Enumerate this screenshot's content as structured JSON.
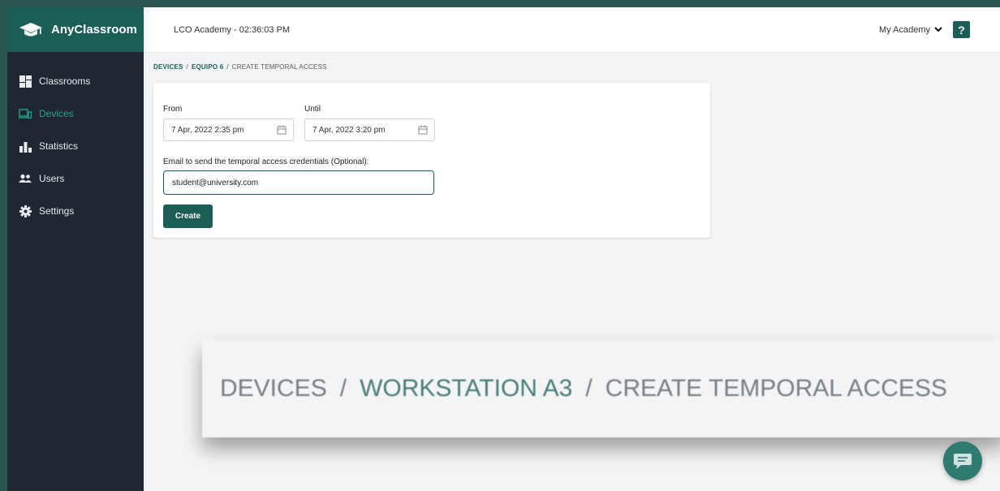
{
  "brand": {
    "name": "AnyClassroom"
  },
  "sidebar": {
    "items": [
      {
        "label": "Classrooms",
        "icon": "dashboard-icon",
        "active": false
      },
      {
        "label": "Devices",
        "icon": "laptop-icon",
        "active": true
      },
      {
        "label": "Statistics",
        "icon": "bar-chart-icon",
        "active": false
      },
      {
        "label": "Users",
        "icon": "users-icon",
        "active": false
      },
      {
        "label": "Settings",
        "icon": "gear-icon",
        "active": false
      }
    ]
  },
  "header": {
    "title": "LCO Academy - 02:36:03 PM",
    "academy_selector": "My Academy",
    "help_label": "?"
  },
  "breadcrumb": {
    "devices": "DEVICES",
    "sep1": "/",
    "device": "EQUIPO 6",
    "sep2": "/",
    "current": "CREATE TEMPORAL ACCESS"
  },
  "form": {
    "from_label": "From",
    "from_value": "7 Apr, 2022 2:35 pm",
    "until_label": "Until",
    "until_value": "7 Apr, 2022 3:20 pm",
    "email_label": "Email to send the temporal access credentials (Optional):",
    "email_value": "student@university.com",
    "create_label": "Create"
  },
  "zoom_overlay": {
    "devices": "DEVICES",
    "sep1": "/",
    "device": "WORKSTATION A3",
    "sep2": "/",
    "current": "CREATE TEMPORAL ACCESS"
  },
  "colors": {
    "brand": "#1b5e57",
    "sidebar_bg": "#1f2733",
    "active_nav": "#1fa58d",
    "chat_bubble": "#2f7a71"
  }
}
